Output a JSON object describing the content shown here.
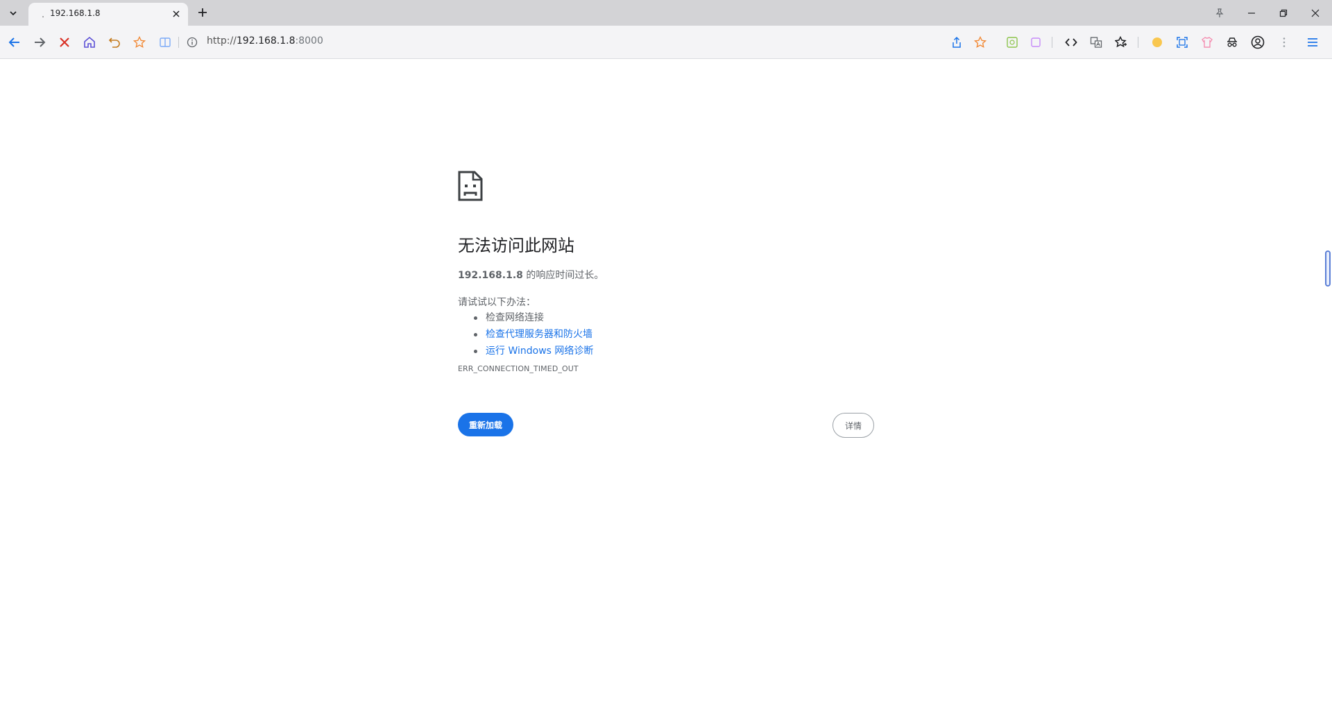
{
  "tab": {
    "title": "192.168.1.8"
  },
  "omnibox": {
    "url_scheme": "http://",
    "url_host": "192.168.1.8",
    "url_rest": ":8000"
  },
  "error": {
    "title": "无法访问此网站",
    "desc_host": "192.168.1.8",
    "desc_text": " 的响应时间过长。",
    "try_label": "请试试以下办法：",
    "suggestions": [
      {
        "text": "检查网络连接",
        "link": false
      },
      {
        "text": "检查代理服务器和防火墙",
        "link": true
      },
      {
        "text": "运行 Windows 网络诊断",
        "link": true
      }
    ],
    "code": "ERR_CONNECTION_TIMED_OUT",
    "reload_label": "重新加载",
    "details_label": "详情"
  },
  "colors": {
    "accent": "#1a73e8",
    "stop_icon": "#d93025",
    "home_icon": "#5b4fd6",
    "undo_icon": "#c47a1c",
    "star_icon": "#f28b38"
  },
  "icons": {
    "tab_list": "chevron-down-icon",
    "tab_close": "close-icon",
    "new_tab": "plus-icon",
    "back": "back-arrow-icon",
    "forward": "forward-arrow-icon",
    "stop": "stop-icon",
    "home": "home-icon",
    "undo": "undo-icon",
    "bookmark": "star-icon",
    "reader": "reader-icon",
    "site_info": "info-icon",
    "share": "share-icon",
    "page_bookmark": "star-icon",
    "devtools": "code-icon",
    "translate": "translate-icon",
    "favorites": "favorites-icon",
    "profile": "profile-icon",
    "menu": "menu-icon",
    "sad_page": "sad-page-icon"
  }
}
